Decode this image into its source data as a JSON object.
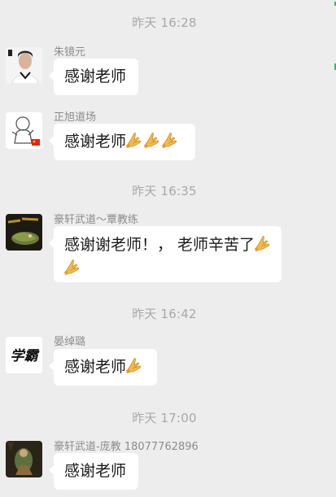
{
  "timestamps": [
    "昨天 16:28",
    "昨天 16:35",
    "昨天 16:42",
    "昨天 17:00"
  ],
  "messages": [
    {
      "sender": "朱镜元",
      "text": "感谢老师",
      "emoji_count": 0,
      "avatar_icon": "man-portrait-avatar"
    },
    {
      "sender": "正旭道场",
      "text": "感谢老师",
      "emoji_count": 3,
      "avatar_icon": "cartoon-mascot-avatar"
    },
    {
      "sender": "豪轩武道～覃教练",
      "text_line1": "感谢谢老师！， 老师辛苦了",
      "emoji_count": 2,
      "avatar_icon": "dragon-calligraphy-avatar"
    },
    {
      "sender": "晏绰璐",
      "text": "感谢老师",
      "emoji_count": 1,
      "avatar_icon": "calligraphy-xueba-avatar",
      "avatar_text": "学霸"
    },
    {
      "sender": "豪轩武道-庞教 18077762896",
      "text": "感谢老师",
      "emoji_count": 0,
      "avatar_icon": "kungfu-photo-avatar"
    }
  ],
  "emoji": "praying-hands-icon",
  "colors": {
    "background": "#ededed",
    "bubble": "#ffffff",
    "emoji": "#f3b94a",
    "accent": "#3bb46a"
  }
}
